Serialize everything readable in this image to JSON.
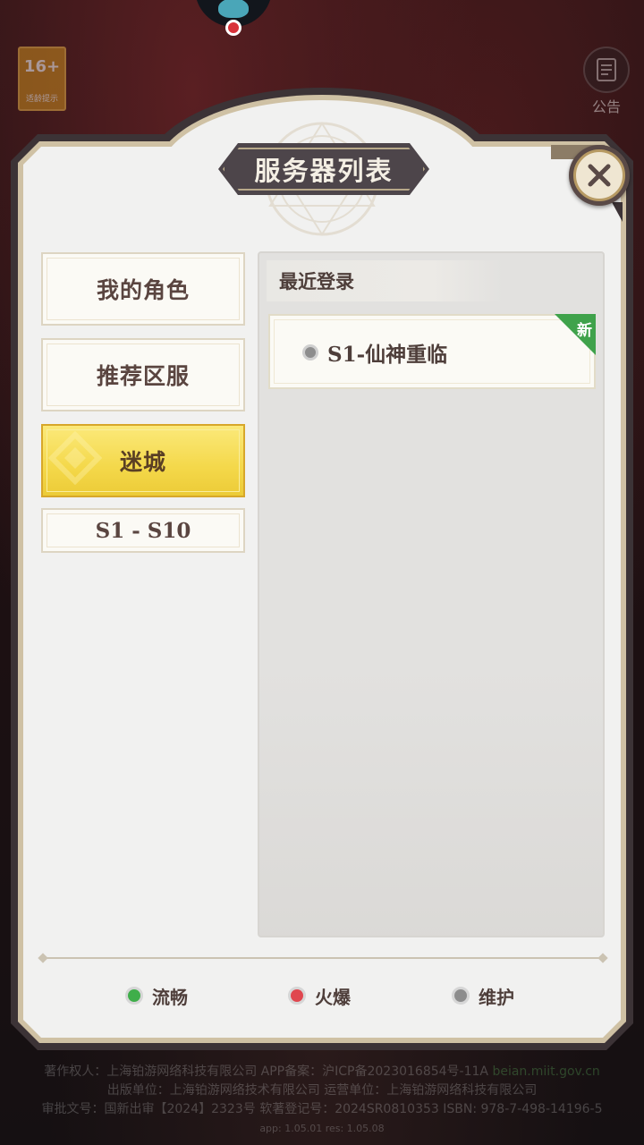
{
  "background": {
    "logo_text": "",
    "age_badge": {
      "number": "16+",
      "caption": "适龄提示"
    },
    "notice_label": "公告",
    "legal_lines": [
      {
        "text": "著作权人：上海铂游网络科技有限公司 APP备案：沪ICP备2023016854号-11A",
        "link": "beian.miit.gov.cn"
      },
      {
        "text": "出版单位：上海铂游网络技术有限公司 运营单位：上海铂游网络科技有限公司",
        "link": ""
      },
      {
        "text": "审批文号：国新出审【2024】2323号 软著登记号：2024SR0810353 ISBN: 978-7-498-14196-5",
        "link": ""
      }
    ],
    "version": "app: 1.05.01 res: 1.05.08"
  },
  "dialog": {
    "title": "服务器列表",
    "close_icon": "close-x-icon",
    "categories": [
      {
        "label": "我的角色",
        "selected": false
      },
      {
        "label": "推荐区服",
        "selected": false
      },
      {
        "label": "迷城",
        "selected": true
      },
      {
        "label": "S1 - S10",
        "selected": false
      }
    ],
    "recent": {
      "header": "最近登录",
      "servers": [
        {
          "name": "S1-仙神重临",
          "status": "maintenance",
          "tag": "新"
        }
      ]
    },
    "legend": [
      {
        "label": "流畅",
        "color": "#3fae4a"
      },
      {
        "label": "火爆",
        "color": "#e0474f"
      },
      {
        "label": "维护",
        "color": "#8d8d8d"
      }
    ]
  },
  "colors": {
    "selected_gold": "#f4d84a",
    "frame_dark": "#3c3336",
    "text_brown": "#4e3e3a"
  }
}
